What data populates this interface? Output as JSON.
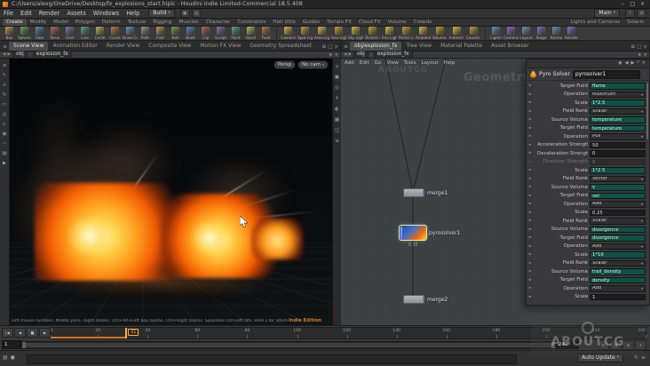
{
  "titlebar": {
    "title": "C:/Users/alexg/OneDrive/Desktop/fx_explosions_start.hiplc - Houdini Indie Limited-Commercial 18.5.408"
  },
  "menubar": {
    "menus": [
      "File",
      "Edit",
      "Render",
      "Assets",
      "Windows",
      "Help"
    ],
    "desktop_combo": "Build",
    "radial_combo": "Main"
  },
  "shelf": {
    "tabs": [
      "Create",
      "Modify",
      "Model",
      "Polygon",
      "Deform",
      "Texture",
      "Rigging",
      "Muscles",
      "Character",
      "Constraints",
      "Hair Utils",
      "Guides",
      "Terrain FX",
      "Cloud FX",
      "Volume",
      "Crowds"
    ],
    "active_tab": "Create",
    "tabs_right": [
      "Lights and Cameras",
      "Solaris"
    ],
    "tools": [
      "Box",
      "Sphere",
      "Tube",
      "Torus",
      "Grid",
      "Line",
      "Circle",
      "Curve",
      "Draw Curve",
      "Path",
      "Font",
      "Null",
      "Blast",
      "Clip",
      "Sculpt",
      "Paint",
      "Bend",
      "Twist"
    ],
    "light_tools": [
      "Camera",
      "Spot Light",
      "Area Light",
      "Geo Light",
      "Sky Light",
      "Distant Light",
      "Env Light",
      "Portal Light",
      "Ambient Light",
      "Volume Light",
      "Indirect Light",
      "Caustic Light"
    ],
    "lop_tools": [
      "Lights",
      "Cameras",
      "Layout",
      "Stage",
      "Karma",
      "Render"
    ]
  },
  "left_pane": {
    "tabs": [
      "Scene View",
      "Animation Editor",
      "Render View",
      "Composite View",
      "Motion FX View",
      "Geometry Spreadsheet"
    ],
    "active_tab": "Scene View",
    "breadcrumb": [
      "obj",
      "explosion_fx"
    ]
  },
  "right_pane": {
    "tabs": [
      "obj/explosion_fx",
      "Tree View",
      "Material Palette",
      "Asset Browser"
    ],
    "active_tab": "obj/explosion_fx",
    "breadcrumb": [
      "obj",
      "explosion_fx"
    ],
    "menus": [
      "Add",
      "Edit",
      "Go",
      "View",
      "Tools",
      "Layout",
      "Help"
    ],
    "context_label": "Geometry"
  },
  "viewport": {
    "persp_label": "Persp",
    "cam_label": "No cam",
    "help_text": "Left mouse tumbles. Middle pans. Right dollies. Ctrl+Alt+Left box zooms. Ctrl+Right zooms. Spacebar-Ctrl-Left tilts. Hold L for alternate tumble, dolly, and zoom.",
    "edition_label": "Indie Edition",
    "left_toolbar_icons": [
      "pane-menu",
      "select-tool",
      "translate-tool",
      "rotate-tool",
      "scale-tool",
      "handle-tool",
      "snap-tool",
      "view-tool",
      "seam-tool",
      "render-region-tool",
      "flipbook-tool"
    ],
    "right_strip_icons": [
      "home-view",
      "frame-view",
      "camera-view",
      "lighting-toggle",
      "shading-mode",
      "grid-toggle",
      "snapshot",
      "display-options"
    ]
  },
  "network": {
    "nodes": [
      {
        "name": "merge1"
      },
      {
        "name": "pyrosolver1",
        "selected": true,
        "badge": "0.35"
      },
      {
        "name": "merge2"
      }
    ]
  },
  "parameters": {
    "node_type": "Pyro Solver",
    "node_name": "pyrosolver1",
    "header_icons": [
      "pin-icon",
      "back-arrow-icon",
      "forward-arrow-icon",
      "gear-icon",
      "close-icon"
    ],
    "rows": [
      {
        "label": "Target Field",
        "kind": "string",
        "value": "flame"
      },
      {
        "label": "Operation",
        "kind": "menu",
        "value": "Maximum"
      },
      {
        "label": "Scale",
        "kind": "string",
        "value": "1*2.5"
      },
      {
        "label": "Field Rank",
        "kind": "menu",
        "value": "Scalar"
      },
      {
        "label": "Source Volume",
        "kind": "string",
        "value": "temperature"
      },
      {
        "label": "Target Field",
        "kind": "string",
        "value": "temperature"
      },
      {
        "label": "Operation",
        "kind": "menu",
        "value": "Pull"
      },
      {
        "label": "Acceleration Strength",
        "kind": "float",
        "value": "50"
      },
      {
        "label": "Deceleration Strength",
        "kind": "float",
        "value": "0"
      },
      {
        "label": "Direction Strength",
        "kind": "float",
        "value": "0",
        "disabled": true
      },
      {
        "label": "Scale",
        "kind": "string",
        "value": "1*2.5"
      },
      {
        "label": "Field Rank",
        "kind": "menu",
        "value": "Vector"
      },
      {
        "label": "Source Volume",
        "kind": "string",
        "value": "v"
      },
      {
        "label": "Target Field",
        "kind": "string",
        "value": "vel"
      },
      {
        "label": "Operation",
        "kind": "menu",
        "value": "Add"
      },
      {
        "label": "Scale",
        "kind": "float",
        "value": "0.25"
      },
      {
        "label": "Field Rank",
        "kind": "menu",
        "value": "Scalar"
      },
      {
        "label": "Source Volume",
        "kind": "string",
        "value": "divergence"
      },
      {
        "label": "Target Field",
        "kind": "string",
        "value": "divergence"
      },
      {
        "label": "Operation",
        "kind": "menu",
        "value": "Add"
      },
      {
        "label": "Scale",
        "kind": "string",
        "value": "1*10"
      },
      {
        "label": "Field Rank",
        "kind": "menu",
        "value": "Scalar"
      },
      {
        "label": "Source Volume",
        "kind": "string",
        "value": "trail_density"
      },
      {
        "label": "Target Field",
        "kind": "string",
        "value": "density"
      },
      {
        "label": "Operation",
        "kind": "menu",
        "value": "Add"
      },
      {
        "label": "Scale",
        "kind": "float",
        "value": "1"
      }
    ]
  },
  "timeline": {
    "current_frame": "31",
    "range_start": "1",
    "range_end": "240",
    "frame_min": 1,
    "frame_max": 240,
    "tick_labels": [
      1,
      20,
      40,
      60,
      80,
      100,
      120,
      140,
      160,
      180,
      200,
      220,
      240
    ],
    "transport_icons": [
      "jump-start",
      "step-back",
      "stop",
      "play",
      "jump-end"
    ],
    "row2_icons": [
      "loop",
      "realtime",
      "global-anim-options",
      "playbar-options"
    ]
  },
  "statusbar": {
    "update_mode": "Auto Update",
    "left_icons": [
      "message-log",
      "badge"
    ],
    "right_icons": [
      "cook-icon",
      "options-icon"
    ]
  },
  "watermarks": {
    "corner_text": "ABOUTCG",
    "network_text": "ABOUTCG"
  },
  "colors": {
    "accent_orange": "#e9953a",
    "expression_teal": "#0d5246",
    "selection_glow": "#dfe8ad"
  }
}
